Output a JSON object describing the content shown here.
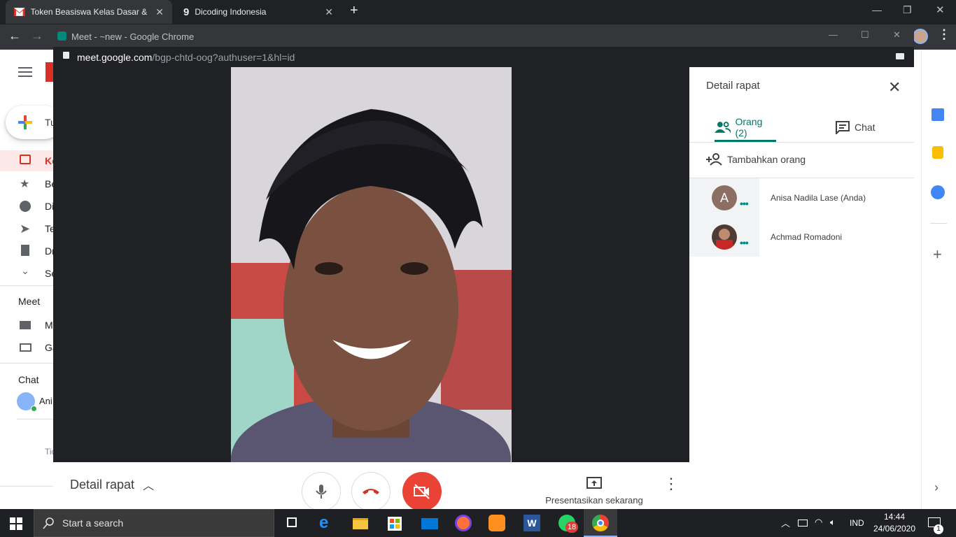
{
  "outer_browser": {
    "tabs": [
      {
        "title": "Token Beasiswa Kelas Dasar & Pe",
        "icon": "gmail-icon",
        "active": true
      },
      {
        "title": "Dicoding Indonesia",
        "icon": "dicoding-icon",
        "active": false
      }
    ],
    "new_tab": "+"
  },
  "gmail": {
    "compose_label": "Tu",
    "nav_items": [
      {
        "label": "Ko",
        "icon": "inbox-icon"
      },
      {
        "label": "Be",
        "icon": "star-icon"
      },
      {
        "label": "Di",
        "icon": "clock-icon"
      },
      {
        "label": "Te",
        "icon": "send-icon"
      },
      {
        "label": "Dr",
        "icon": "draft-icon"
      },
      {
        "label": "Se",
        "icon": "chevron-down-icon"
      }
    ],
    "meet_heading": "Meet",
    "meet_items": [
      {
        "label": "M",
        "icon": "video-icon"
      },
      {
        "label": "Ga",
        "icon": "keyboard-icon"
      }
    ],
    "chat_heading": "Chat",
    "chat_user": "Ani",
    "footer_text": "Tic",
    "account_initial": "A"
  },
  "popup": {
    "window_title": "Meet - ~new - Google Chrome",
    "url_domain": "meet.google.com",
    "url_path": "/bgp-chtd-oog?authuser=1&hl=id"
  },
  "meeting": {
    "details_label": "Detail rapat",
    "present_label": "Presentasikan sekarang"
  },
  "side_panel": {
    "title": "Detail rapat",
    "tab_people": "Orang (2)",
    "tab_chat": "Chat",
    "add_people": "Tambahkan orang",
    "participants": [
      {
        "name": "Anisa Nadila Lase (Anda)",
        "initial": "A"
      },
      {
        "name": "Achmad Romadoni",
        "initial": ""
      }
    ]
  },
  "taskbar": {
    "search_placeholder": "Start a search",
    "whatsapp_badge": "18",
    "language": "IND",
    "time": "14:44",
    "date": "24/06/2020",
    "notification_count": "1"
  },
  "colors": {
    "meet_teal": "#00796b",
    "hangup_red": "#ea4335",
    "gmail_red": "#d93025"
  }
}
